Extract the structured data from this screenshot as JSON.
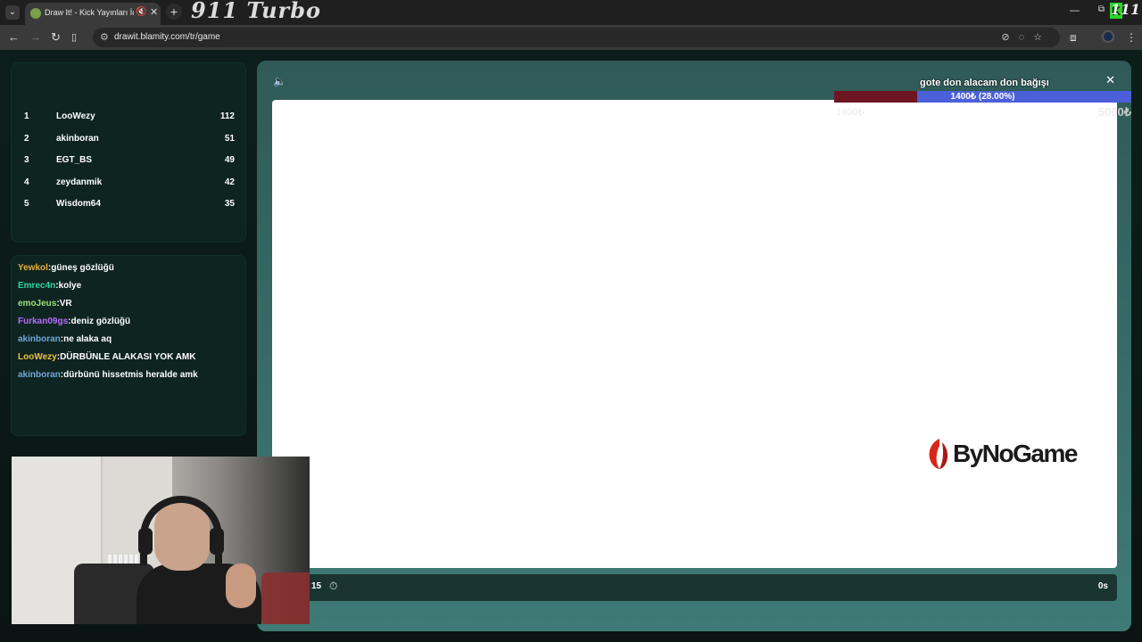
{
  "browser": {
    "tab_title": "Draw It! - Kick Yayınları İçin",
    "url": "drawit.blamity.com/tr/game",
    "overlay_title": "911 Turbo",
    "corner_badge": "111",
    "kick_letter": "K"
  },
  "leaderboard": {
    "rows": [
      {
        "rank": "1",
        "name": "LooWezy",
        "score": "112"
      },
      {
        "rank": "2",
        "name": "akinboran",
        "score": "51"
      },
      {
        "rank": "3",
        "name": "EGT_BS",
        "score": "49"
      },
      {
        "rank": "4",
        "name": "zeydanmik",
        "score": "42"
      },
      {
        "rank": "5",
        "name": "Wisdom64",
        "score": "35"
      }
    ]
  },
  "chat": {
    "messages": [
      {
        "user": "Yewkol",
        "text": "güneş gözlüğü",
        "color": "#e8b040"
      },
      {
        "user": "Emrec4n",
        "text": "kolye",
        "color": "#2ed6a0"
      },
      {
        "user": "emoJeus",
        "text": "VR",
        "color": "#9be07a"
      },
      {
        "user": "Furkan09gs",
        "text": "deniz gözlüğü",
        "color": "#b66cff"
      },
      {
        "user": "akinboran",
        "text": "ne alaka aq",
        "color": "#6fa8dc"
      },
      {
        "user": "LooWezy",
        "text": "DÜRBÜNLE ALAKASI YOK AMK",
        "color": "#f0c040"
      },
      {
        "user": "akinboran",
        "text": "dürbünü hissetmis heralde amk",
        "color": "#6fa8dc"
      }
    ]
  },
  "game": {
    "sponsor": "ByNoGame",
    "round_number": "15",
    "time_left": "0s"
  },
  "donation": {
    "title": "gote don alacam don bağışı",
    "label": "1400₺ (28.00%)",
    "progress": 0.28,
    "min": "1400₺",
    "max": "5000₺"
  }
}
